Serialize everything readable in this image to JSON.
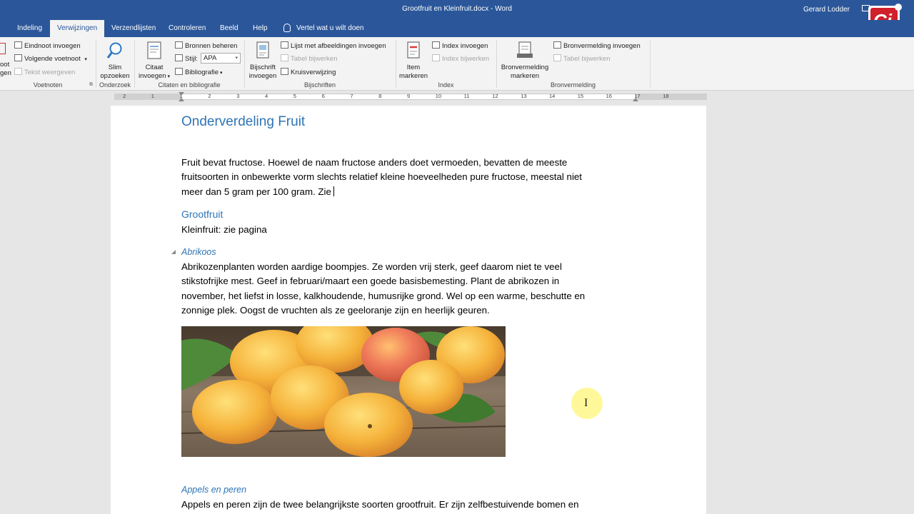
{
  "window": {
    "title": "Grootfruit en Kleinfruit.docx - Word",
    "user": "Gerard Lodder",
    "logo_text": "Ci"
  },
  "tabs": [
    {
      "label": "Indeling"
    },
    {
      "label": "Verwijzingen",
      "active": true
    },
    {
      "label": "Verzendlijsten"
    },
    {
      "label": "Controleren"
    },
    {
      "label": "Beeld"
    },
    {
      "label": "Help"
    }
  ],
  "tell_me": "Vertel wat u wilt doen",
  "ribbon": {
    "footnotes": {
      "partial_big_top": "oot",
      "partial_big_bottom": "gen",
      "insert_endnote": "Eindnoot invoegen",
      "next_footnote": "Volgende voetnoot",
      "show_notes": "Tekst weergeven",
      "group_label": "Voetnoten"
    },
    "research": {
      "smart_lookup_line1": "Slim",
      "smart_lookup_line2": "opzoeken",
      "group_label": "Onderzoek"
    },
    "citations": {
      "insert_citation_line1": "Citaat",
      "insert_citation_line2": "invoegen",
      "manage_sources": "Bronnen beheren",
      "style_label": "Stijl:",
      "style_value": "APA",
      "bibliography": "Bibliografie",
      "group_label": "Citaten en bibliografie"
    },
    "captions": {
      "insert_caption_line1": "Bijschrift",
      "insert_caption_line2": "invoegen",
      "insert_table_of_figures": "Lijst met afbeeldingen invoegen",
      "update_table": "Tabel bijwerken",
      "cross_reference": "Kruisverwijzing",
      "group_label": "Bijschriften"
    },
    "index": {
      "mark_entry_line1": "Item",
      "mark_entry_line2": "markeren",
      "insert_index": "Index invoegen",
      "update_index": "Index bijwerken",
      "group_label": "Index"
    },
    "table_of_authorities": {
      "mark_citation_line1": "Bronvermelding",
      "mark_citation_line2": "markeren",
      "insert_table": "Bronvermelding invoegen",
      "update_table": "Tabel bijwerken",
      "group_label": "Bronvermelding"
    }
  },
  "ruler": {
    "numbers": [
      "2",
      "1",
      "1",
      "2",
      "3",
      "4",
      "5",
      "6",
      "7",
      "8",
      "9",
      "10",
      "11",
      "12",
      "13",
      "14",
      "15",
      "16",
      "17",
      "18"
    ]
  },
  "document": {
    "heading1": "Onderverdeling Fruit",
    "intro_line1": "Fruit bevat fructose. Hoewel de naam fructose anders doet vermoeden, bevatten de meeste",
    "intro_line2": "fruitsoorten in onbewerkte vorm slechts relatief kleine hoeveelheden pure fructose, meestal niet",
    "intro_line3": "meer dan 5 gram per 100 gram. Zie",
    "heading2": "Grootfruit",
    "kleinfruit_line": "Kleinfruit: zie pagina",
    "heading3_apricot": "Abrikoos",
    "apricot_line1": "Abrikozenplanten worden aardige boompjes. Ze worden vrij sterk, geef daarom niet te veel",
    "apricot_line2": "stikstofrijke mest. Geef in februari/maart een goede basisbemesting. Plant de abrikozen in",
    "apricot_line3": "november, het liefst in losse, kalkhoudende, humusrijke grond. Wel op een warme, beschutte en",
    "apricot_line4": "zonnige plek. Oogst de vruchten als ze geeloranje zijn en heerlijk geuren.",
    "heading3_apples": "Appels en peren",
    "apples_line1": "Appels en peren zijn de twee belangrijkste soorten grootfruit. Er zijn zelfbestuivende bomen en"
  },
  "colors": {
    "word_blue": "#2b579a",
    "heading_blue": "#2e74b5"
  }
}
